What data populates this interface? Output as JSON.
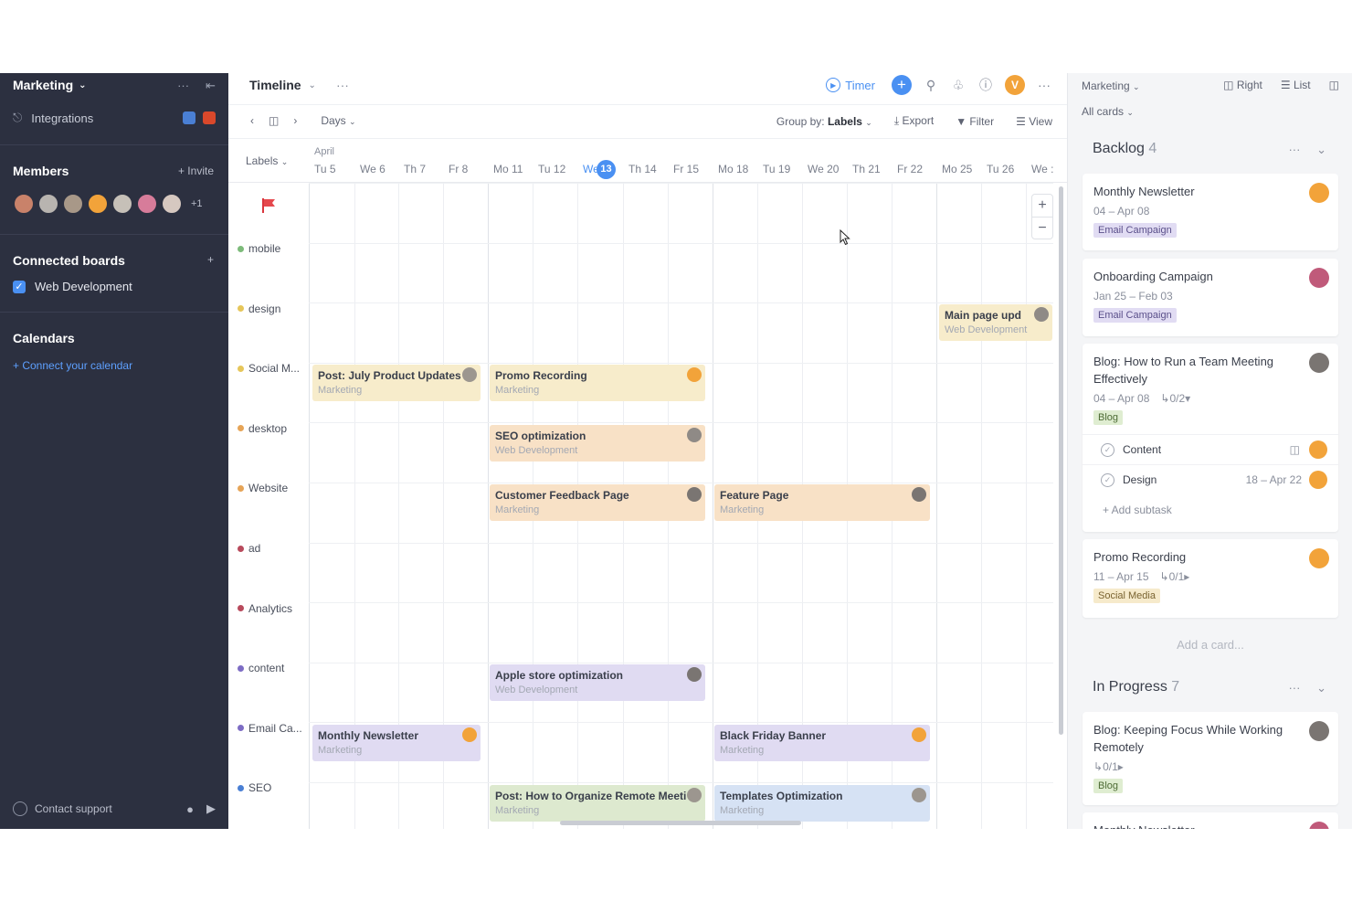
{
  "sidebar": {
    "workspace": "Marketing",
    "integrations": "Integrations",
    "members_title": "Members",
    "invite": "+ Invite",
    "members_more": "+1",
    "boards_title": "Connected boards",
    "board_item": "Web Development",
    "calendars_title": "Calendars",
    "connect_calendar": "+ Connect your calendar",
    "contact_support": "Contact support"
  },
  "main": {
    "title": "Timeline",
    "timer": "Timer",
    "user_initial": "V",
    "toolbar": {
      "days": "Days",
      "group_by_label": "Group by:",
      "group_by_value": "Labels",
      "export": "Export",
      "filter": "Filter",
      "view": "View"
    },
    "labels_dropdown": "Labels",
    "month": "April",
    "days": [
      "Tu 5",
      "We 6",
      "Th 7",
      "Fr 8",
      "Mo 11",
      "Tu 12",
      "We",
      "Th 14",
      "Fr 15",
      "Mo 18",
      "Tu 19",
      "We 20",
      "Th 21",
      "Fr 22",
      "Mo 25",
      "Tu 26",
      "We :"
    ],
    "today": "13",
    "rows": [
      "mobile",
      "design",
      "Social M...",
      "desktop",
      "Website",
      "ad",
      "Analytics",
      "content",
      "Email Ca...",
      "SEO"
    ],
    "row_colors": [
      "#7dbb7a",
      "#e6c65a",
      "#e6c65a",
      "#e6a457",
      "#e6a457",
      "#b84a5c",
      "#b84a5c",
      "#7d6cc4",
      "#7d6cc4",
      "#4a7fd4"
    ],
    "cards": [
      {
        "title": "Main page upd",
        "board": "Web Development"
      },
      {
        "title": "Post: July Product Updates",
        "board": "Marketing"
      },
      {
        "title": "Promo Recording",
        "board": "Marketing"
      },
      {
        "title": "SEO optimization",
        "board": "Web Development"
      },
      {
        "title": "Customer Feedback Page",
        "board": "Marketing"
      },
      {
        "title": "Feature Page",
        "board": "Marketing"
      },
      {
        "title": "Apple store optimization",
        "board": "Web Development"
      },
      {
        "title": "Monthly Newsletter",
        "board": "Marketing"
      },
      {
        "title": "Black Friday Banner",
        "board": "Marketing"
      },
      {
        "title": "Post: How to Organize Remote Meeti",
        "board": "Marketing"
      },
      {
        "title": "Templates Optimization",
        "board": "Marketing"
      }
    ]
  },
  "right_panel": {
    "board": "Marketing",
    "right": "Right",
    "list": "List",
    "filter": "All cards",
    "backlog": {
      "title": "Backlog",
      "count": "4"
    },
    "in_progress": {
      "title": "In Progress",
      "count": "7"
    },
    "cards": [
      {
        "title": "Monthly Newsletter",
        "dates": "04 – Apr 08",
        "tag": "Email Campaign"
      },
      {
        "title": "Onboarding Campaign",
        "dates": "Jan 25 – Feb 03",
        "tag": "Email Campaign"
      },
      {
        "title": "Blog: How to Run a Team Meeting Effectively",
        "dates": "04 – Apr 08",
        "subtasks": "0/2",
        "tag": "Blog"
      },
      {
        "title": "Promo Recording",
        "dates": "11 – Apr 15",
        "subtasks": "0/1",
        "tag": "Social Media"
      },
      {
        "title": "Blog: Keeping Focus While Working Remotely",
        "subtasks": "0/1",
        "tag": "Blog"
      }
    ],
    "subtask_items": [
      {
        "label": "Content"
      },
      {
        "label": "Design",
        "dates": "18 – Apr 22"
      }
    ],
    "add_subtask": "+ Add subtask",
    "add_card": "Add a card...",
    "partial_card": "Monthly Newsletter"
  },
  "colors": {
    "sidebar_bg": "#2c3040",
    "accent": "#4a90f2"
  }
}
